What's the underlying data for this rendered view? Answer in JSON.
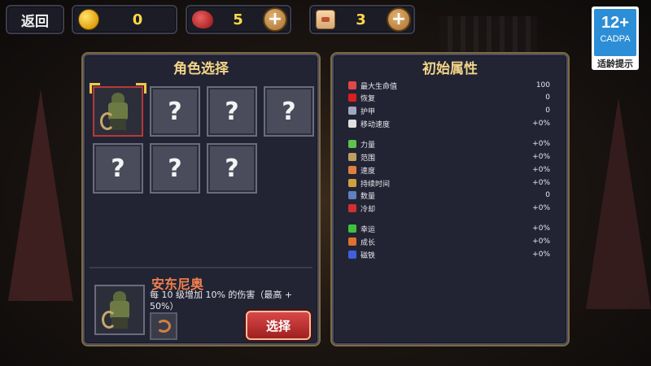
{
  "topbar": {
    "back_label": "返回",
    "coins": "0",
    "meat": "5",
    "scrolls": "3"
  },
  "age_badge": {
    "rating": "12+",
    "org": "CADPA",
    "tip": "适龄提示"
  },
  "character_panel": {
    "title": "角色选择",
    "slots": [
      "?",
      "?",
      "?",
      "?",
      "?",
      "?"
    ],
    "selected": {
      "name": "安东尼奥",
      "description": "每 10 级增加 10% 的伤害（最高 + 50%）",
      "select_label": "选择"
    }
  },
  "stats_panel": {
    "title": "初始属性",
    "stats": [
      {
        "label": "最大生命值",
        "value": "100",
        "icon": "heart-icon",
        "color": "#e04848"
      },
      {
        "label": "恢复",
        "value": "0",
        "icon": "heart-regen-icon",
        "color": "#d82020"
      },
      {
        "label": "护甲",
        "value": "0",
        "icon": "armor-icon",
        "color": "#a0a8c0"
      },
      {
        "label": "移动速度",
        "value": "+0%",
        "icon": "wing-icon",
        "color": "#e0e0e0"
      },
      {
        "label": "力量",
        "value": "+0%",
        "icon": "sword-icon",
        "color": "#60c050"
      },
      {
        "label": "范围",
        "value": "+0%",
        "icon": "area-icon",
        "color": "#c0a060"
      },
      {
        "label": "速度",
        "value": "+0%",
        "icon": "speed-icon",
        "color": "#e08040"
      },
      {
        "label": "持续时间",
        "value": "+0%",
        "icon": "duration-icon",
        "color": "#d0a040"
      },
      {
        "label": "数量",
        "value": "0",
        "icon": "amount-icon",
        "color": "#6080c0"
      },
      {
        "label": "冷却",
        "value": "+0%",
        "icon": "cooldown-icon",
        "color": "#d03030"
      },
      {
        "label": "幸运",
        "value": "+0%",
        "icon": "clover-icon",
        "color": "#40c040"
      },
      {
        "label": "成长",
        "value": "+0%",
        "icon": "growth-icon",
        "color": "#e07030"
      },
      {
        "label": "磁铁",
        "value": "+0%",
        "icon": "magnet-icon",
        "color": "#4060e0"
      }
    ]
  },
  "colors": {
    "accent_gold": "#f2d488",
    "name_orange": "#f08050",
    "button_red": "#c03030",
    "resource_yellow": "#ffd84a"
  }
}
